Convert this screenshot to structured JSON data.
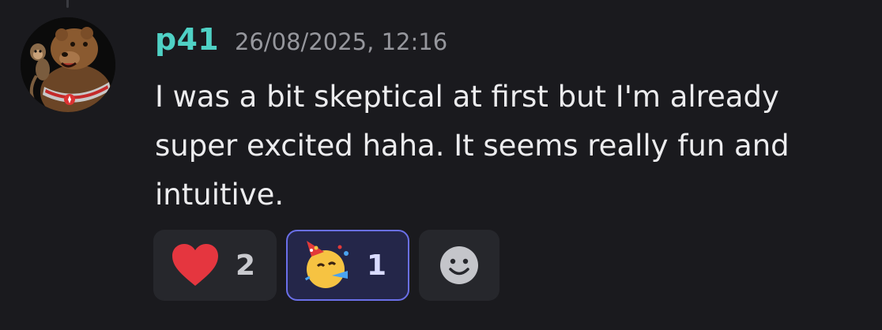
{
  "message": {
    "author": "p41",
    "timestamp": "26/08/2025, 12:16",
    "text": "I was a bit skeptical at first but I'm already super excited haha. It seems really fun and intuitive.",
    "avatar_icon": "bear-monkey-avatar"
  },
  "reactions": [
    {
      "emoji": "heart-icon",
      "count": "2",
      "selected": false
    },
    {
      "emoji": "party-face-icon",
      "count": "1",
      "selected": true
    }
  ],
  "add_reaction_icon": "smiley-add-reaction-icon",
  "colors": {
    "background": "#1a1a1e",
    "username": "#4fd1c5",
    "selected_border": "#6a6fe8",
    "heart": "#e5363f"
  }
}
